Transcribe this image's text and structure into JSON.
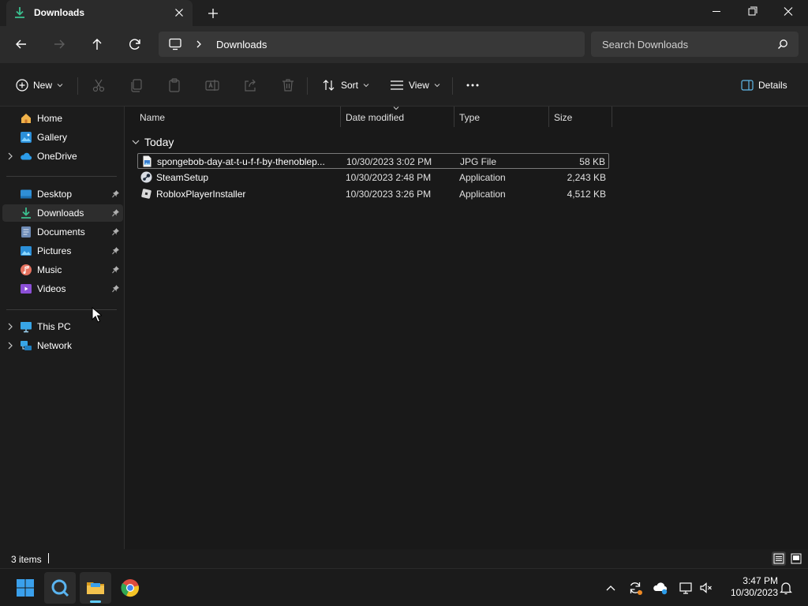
{
  "window": {
    "tab_title": "Downloads",
    "tab_icon": "downloads-icon"
  },
  "address": {
    "breadcrumb": "Downloads",
    "search_placeholder": "Search Downloads"
  },
  "commands": {
    "new_label": "New",
    "sort_label": "Sort",
    "view_label": "View",
    "details_label": "Details"
  },
  "sidebar": {
    "top_items": [
      {
        "label": "Home",
        "icon": "home-icon"
      },
      {
        "label": "Gallery",
        "icon": "gallery-icon"
      },
      {
        "label": "OneDrive",
        "icon": "onedrive-icon"
      }
    ],
    "quick_access": [
      {
        "label": "Desktop",
        "icon": "desktop-icon"
      },
      {
        "label": "Downloads",
        "icon": "downloads-icon",
        "selected": true
      },
      {
        "label": "Documents",
        "icon": "documents-icon"
      },
      {
        "label": "Pictures",
        "icon": "pictures-icon"
      },
      {
        "label": "Music",
        "icon": "music-icon"
      },
      {
        "label": "Videos",
        "icon": "videos-icon"
      }
    ],
    "bottom_items": [
      {
        "label": "This PC",
        "icon": "this-pc-icon"
      },
      {
        "label": "Network",
        "icon": "network-icon"
      }
    ]
  },
  "columns": {
    "name": "Name",
    "date": "Date modified",
    "type": "Type",
    "size": "Size"
  },
  "group_label": "Today",
  "files": [
    {
      "name": "spongebob-day-at-t-u-f-f-by-thenoblep...",
      "date": "10/30/2023 3:02 PM",
      "type": "JPG File",
      "size": "58 KB",
      "icon": "jpg-file-icon",
      "selected": true
    },
    {
      "name": "SteamSetup",
      "date": "10/30/2023 2:48 PM",
      "type": "Application",
      "size": "2,243 KB",
      "icon": "steam-icon"
    },
    {
      "name": "RobloxPlayerInstaller",
      "date": "10/30/2023 3:26 PM",
      "type": "Application",
      "size": "4,512 KB",
      "icon": "roblox-icon"
    }
  ],
  "status": {
    "item_count": "3 items"
  },
  "taskbar": {
    "time": "3:47 PM",
    "date": "10/30/2023"
  },
  "colors": {
    "accent": "#60cdff",
    "background": "#191919",
    "folder": "#f4c24d",
    "downloads_green": "#3bbf8f"
  }
}
